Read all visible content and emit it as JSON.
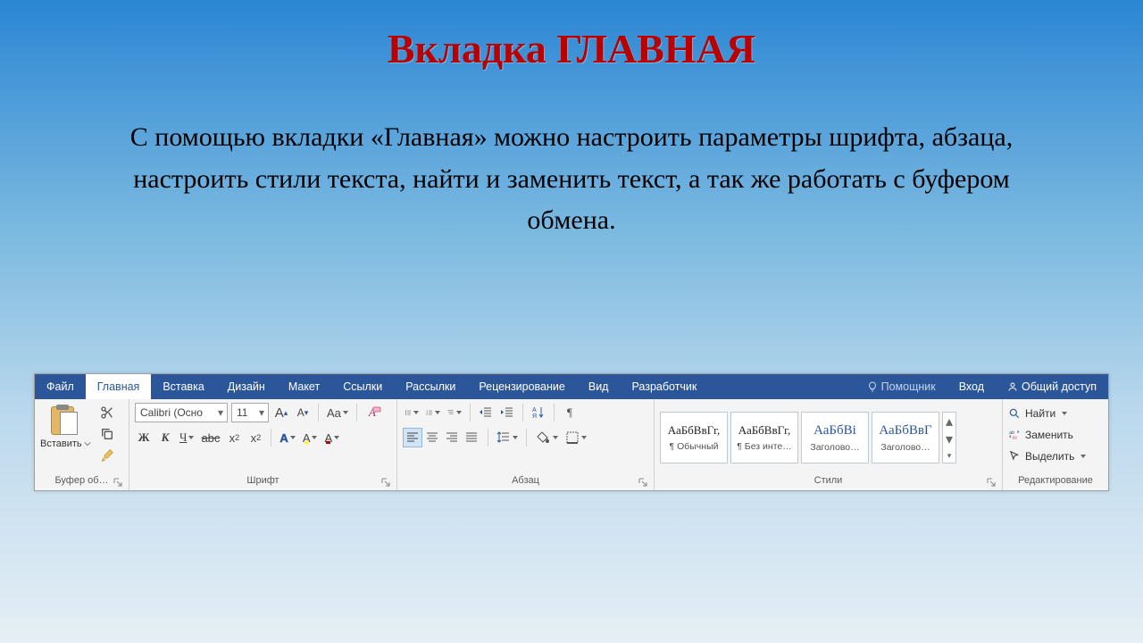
{
  "slide": {
    "title": "Вкладка ГЛАВНАЯ",
    "body": "С помощью вкладки «Главная» можно настроить параметры шрифта, абзаца, настроить стили текста, найти и заменить текст, а так же работать с буфером обмена."
  },
  "tabs": {
    "file": "Файл",
    "home": "Главная",
    "insert": "Вставка",
    "design": "Дизайн",
    "layout": "Макет",
    "references": "Ссылки",
    "mailings": "Рассылки",
    "review": "Рецензирование",
    "view": "Вид",
    "developer": "Разработчик",
    "tellme": "Помощник",
    "signin": "Вход",
    "share": "Общий доступ"
  },
  "clipboard": {
    "paste": "Вставить",
    "group_label": "Буфер об…"
  },
  "font": {
    "name": "Calibri (Осно",
    "size": "11",
    "case": "Aa",
    "group_label": "Шрифт"
  },
  "paragraph": {
    "group_label": "Абзац"
  },
  "styles": {
    "preview_normal": "АаБбВвГг,",
    "preview_heading": "АаБбВі",
    "preview_heading2": "АаБбВвГ",
    "normal": "¶ Обычный",
    "nospacing": "¶ Без инте…",
    "heading1": "Заголово…",
    "heading2": "Заголово…",
    "group_label": "Стили"
  },
  "editing": {
    "find": "Найти",
    "replace": "Заменить",
    "select": "Выделить",
    "group_label": "Редактирование"
  }
}
